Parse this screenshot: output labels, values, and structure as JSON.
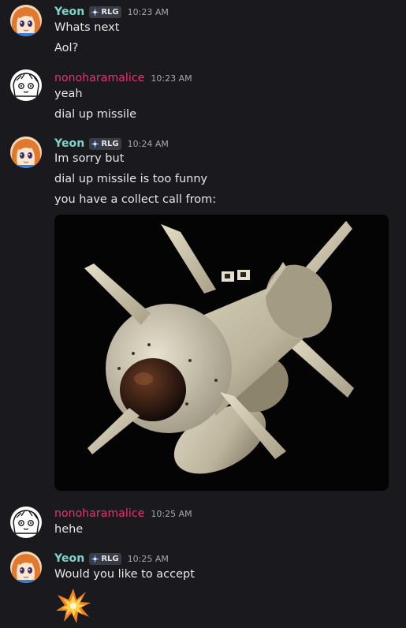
{
  "messages": [
    {
      "author": "Yeon",
      "tag": "RLG",
      "time": "10:23 AM",
      "lines": [
        "Whats next",
        "Aol?"
      ]
    },
    {
      "author": "nonoharamalice",
      "time": "10:23 AM",
      "lines": [
        "yeah",
        "dial up missile"
      ]
    },
    {
      "author": "Yeon",
      "tag": "RLG",
      "time": "10:24 AM",
      "lines": [
        "Im sorry but",
        "dial up missile is too funny",
        "you have a collect call from:"
      ],
      "attachment": "missile-image"
    },
    {
      "author": "nonoharamalice",
      "time": "10:25 AM",
      "lines": [
        "hehe"
      ]
    },
    {
      "author": "Yeon",
      "tag": "RLG",
      "time": "10:25 AM",
      "lines": [
        "Would you like to accept"
      ],
      "emoji": "collision-emoji"
    }
  ],
  "colors": {
    "background": "#1a1a1e",
    "yeon_name": "#7fd3c7",
    "nono_name": "#e0366f",
    "text": "#e6e7ea",
    "timestamp": "#a5a8ae"
  }
}
